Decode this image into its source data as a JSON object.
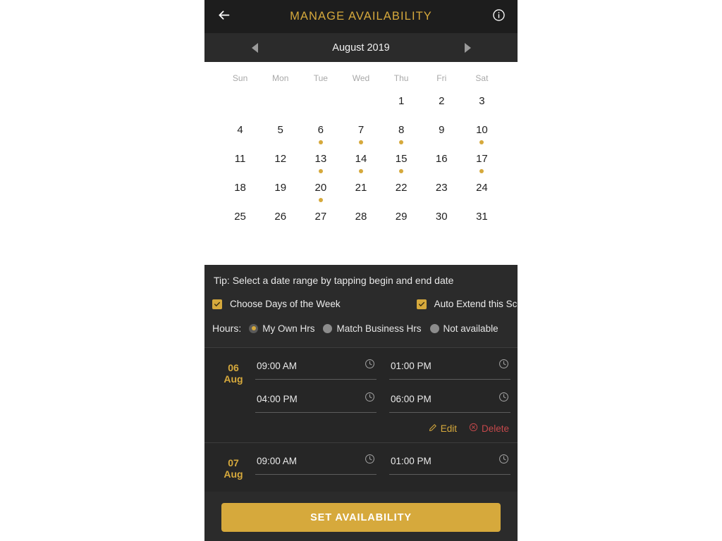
{
  "appbar": {
    "back_icon": "arrow-left-icon",
    "title": "MANAGE AVAILABILITY",
    "info_icon": "info-icon"
  },
  "month_nav": {
    "prev_icon": "chevron-left-icon",
    "next_icon": "chevron-right-icon",
    "month_label": "August 2019"
  },
  "calendar": {
    "weekdays": [
      "Sun",
      "Mon",
      "Tue",
      "Wed",
      "Thu",
      "Fri",
      "Sat"
    ],
    "leading_blanks": 4,
    "days": [
      {
        "n": "1",
        "dot": false
      },
      {
        "n": "2",
        "dot": false
      },
      {
        "n": "3",
        "dot": false
      },
      {
        "n": "4",
        "dot": false
      },
      {
        "n": "5",
        "dot": false
      },
      {
        "n": "6",
        "dot": true
      },
      {
        "n": "7",
        "dot": true
      },
      {
        "n": "8",
        "dot": true
      },
      {
        "n": "9",
        "dot": false
      },
      {
        "n": "10",
        "dot": true
      },
      {
        "n": "11",
        "dot": false
      },
      {
        "n": "12",
        "dot": false
      },
      {
        "n": "13",
        "dot": true
      },
      {
        "n": "14",
        "dot": true
      },
      {
        "n": "15",
        "dot": true
      },
      {
        "n": "16",
        "dot": false
      },
      {
        "n": "17",
        "dot": true
      },
      {
        "n": "18",
        "dot": false
      },
      {
        "n": "19",
        "dot": false
      },
      {
        "n": "20",
        "dot": true
      },
      {
        "n": "21",
        "dot": false
      },
      {
        "n": "22",
        "dot": false
      },
      {
        "n": "23",
        "dot": false
      },
      {
        "n": "24",
        "dot": false
      },
      {
        "n": "25",
        "dot": false
      },
      {
        "n": "26",
        "dot": false
      },
      {
        "n": "27",
        "dot": false
      },
      {
        "n": "28",
        "dot": false
      },
      {
        "n": "29",
        "dot": false
      },
      {
        "n": "30",
        "dot": false
      },
      {
        "n": "31",
        "dot": false
      }
    ]
  },
  "tip": "Tip: Select a date range by tapping begin and end date",
  "checkboxes": [
    {
      "label": "Choose Days of the Week",
      "checked": true
    },
    {
      "label": "Auto Extend this Schedule",
      "checked": true
    }
  ],
  "hours": {
    "label": "Hours:",
    "options": [
      {
        "label": "My Own Hrs",
        "selected": true
      },
      {
        "label": "Match Business Hrs",
        "selected": false
      },
      {
        "label": "Not available",
        "selected": false
      }
    ]
  },
  "slots": [
    {
      "day": "06",
      "month": "Aug",
      "rows": [
        {
          "start": "09:00 AM",
          "end": "01:00 PM"
        },
        {
          "start": "04:00 PM",
          "end": "06:00 PM"
        }
      ],
      "has_actions": true,
      "edit_label": "Edit",
      "delete_label": "Delete"
    },
    {
      "day": "07",
      "month": "Aug",
      "rows": [
        {
          "start": "09:00 AM",
          "end": "01:00 PM"
        }
      ],
      "has_actions": false,
      "edit_label": "Edit",
      "delete_label": "Delete"
    }
  ],
  "cta": {
    "label": "SET AVAILABILITY"
  },
  "colors": {
    "accent_gold": "#d6a93c",
    "danger_red": "#c4484b",
    "appbar_bg": "#1d1d1d",
    "sheet_bg": "#2b2b2b",
    "slot_bg": "#262626"
  }
}
